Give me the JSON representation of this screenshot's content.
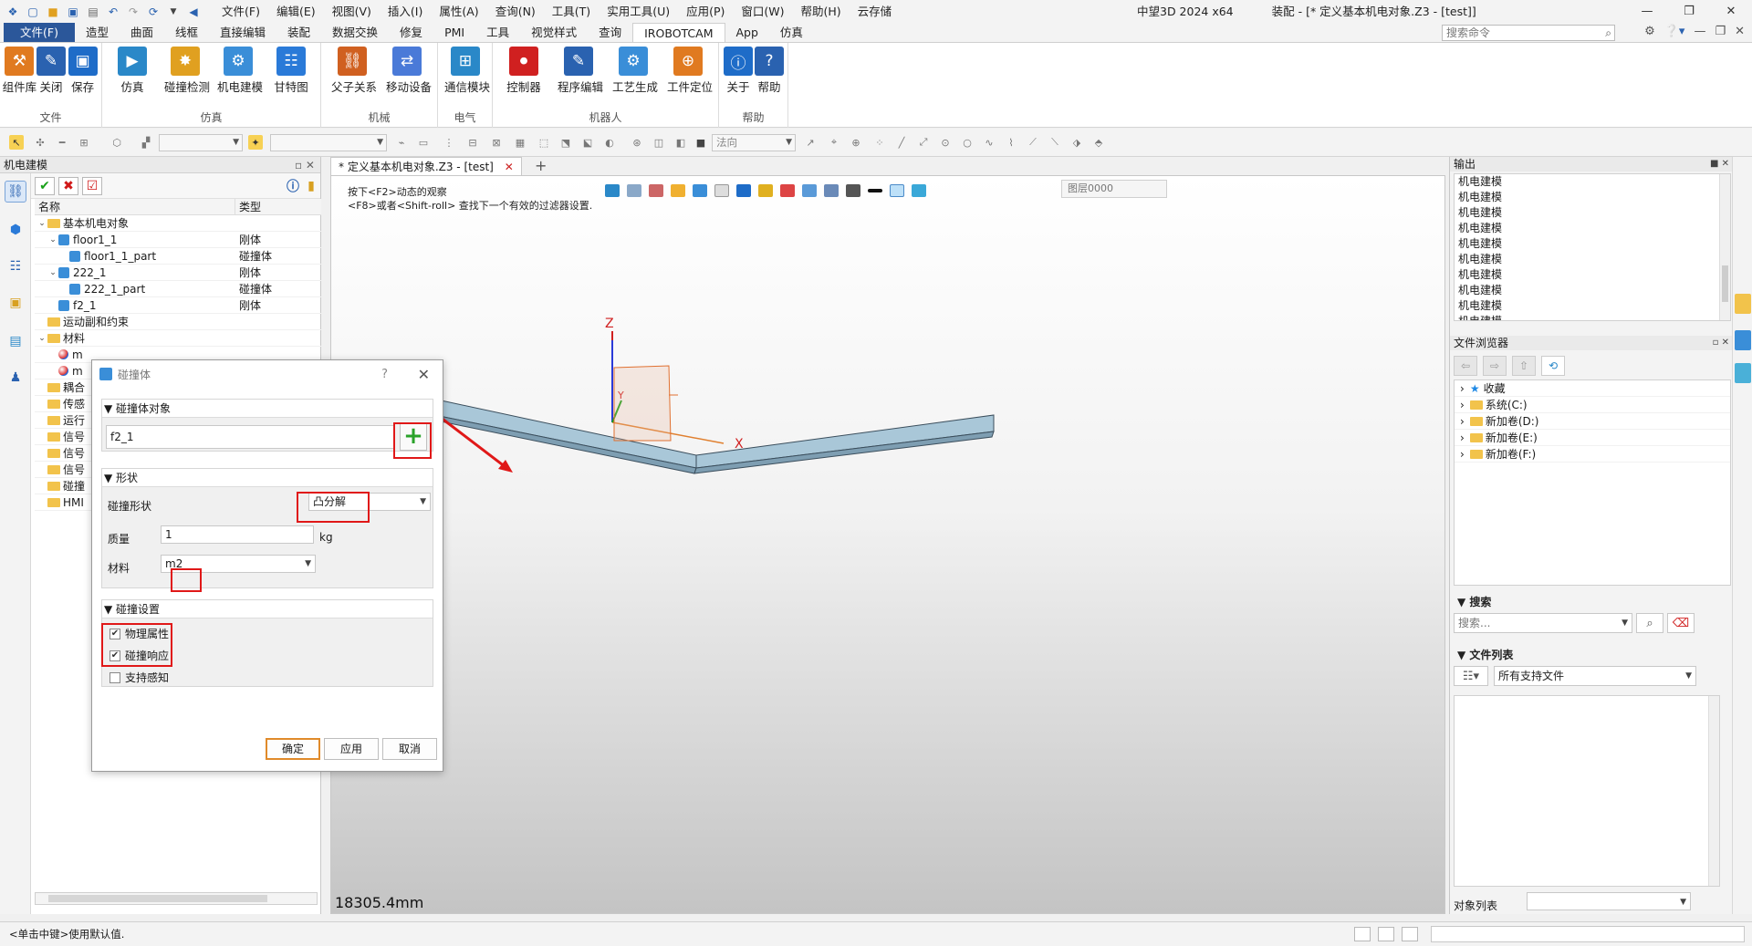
{
  "titlebar": {
    "menu": [
      "文件(F)",
      "编辑(E)",
      "视图(V)",
      "插入(I)",
      "属性(A)",
      "查询(N)",
      "工具(T)",
      "实用工具(U)",
      "应用(P)",
      "窗口(W)",
      "帮助(H)",
      "云存储"
    ],
    "app_name": "中望3D 2024 x64",
    "doc_title": "装配 - [* 定义基本机电对象.Z3 - [test]]",
    "search_placeholder": "搜索命令"
  },
  "ribbon_tabs": [
    "文件(F)",
    "造型",
    "曲面",
    "线框",
    "直接编辑",
    "装配",
    "数据交换",
    "修复",
    "PMI",
    "工具",
    "视觉样式",
    "查询",
    "IROBOTCAM",
    "App",
    "仿真"
  ],
  "ribbon_active_tab": "IROBOTCAM",
  "ribbon": {
    "groups": [
      {
        "label": "文件",
        "buttons": [
          "组件库",
          "关闭",
          "保存"
        ]
      },
      {
        "label": "仿真",
        "buttons": [
          "仿真",
          "碰撞检测",
          "机电建模",
          "甘特图"
        ]
      },
      {
        "label": "机械",
        "buttons": [
          "父子关系",
          "移动设备"
        ]
      },
      {
        "label": "电气",
        "buttons": [
          "通信模块"
        ]
      },
      {
        "label": "机器人",
        "buttons": [
          "控制器",
          "程序编辑",
          "工艺生成",
          "工件定位"
        ]
      },
      {
        "label": "帮助",
        "buttons": [
          "关于",
          "帮助"
        ]
      }
    ]
  },
  "toolbar": {
    "filter_combo": "法向"
  },
  "left_panel": {
    "title": "机电建模",
    "columns": [
      "名称",
      "类型"
    ],
    "tree": [
      {
        "name": "基本机电对象",
        "type": "",
        "level": 0,
        "kind": "folder",
        "expanded": true
      },
      {
        "name": "floor1_1",
        "type": "刚体",
        "level": 1,
        "kind": "cube",
        "expanded": true
      },
      {
        "name": "floor1_1_part",
        "type": "碰撞体",
        "level": 2,
        "kind": "cube"
      },
      {
        "name": "222_1",
        "type": "刚体",
        "level": 1,
        "kind": "cube",
        "expanded": true
      },
      {
        "name": "222_1_part",
        "type": "碰撞体",
        "level": 2,
        "kind": "cube"
      },
      {
        "name": "f2_1",
        "type": "刚体",
        "level": 1,
        "kind": "cube"
      },
      {
        "name": "运动副和约束",
        "type": "",
        "level": 0,
        "kind": "folder"
      },
      {
        "name": "材料",
        "type": "",
        "level": 0,
        "kind": "folder",
        "expanded": true
      },
      {
        "name": "m",
        "type": "",
        "level": 1,
        "kind": "ball"
      },
      {
        "name": "m",
        "type": "",
        "level": 1,
        "kind": "ball"
      },
      {
        "name": "耦合",
        "type": "",
        "level": 0,
        "kind": "folder"
      },
      {
        "name": "传感",
        "type": "",
        "level": 0,
        "kind": "folder"
      },
      {
        "name": "运行",
        "type": "",
        "level": 0,
        "kind": "folder"
      },
      {
        "name": "信号",
        "type": "",
        "level": 0,
        "kind": "folder"
      },
      {
        "name": "信号",
        "type": "",
        "level": 0,
        "kind": "folder"
      },
      {
        "name": "信号",
        "type": "",
        "level": 0,
        "kind": "folder"
      },
      {
        "name": "碰撞",
        "type": "",
        "level": 0,
        "kind": "folder"
      },
      {
        "name": "HMI",
        "type": "",
        "level": 0,
        "kind": "folder"
      }
    ]
  },
  "document_tab": "* 定义基本机电对象.Z3 - [test]",
  "viewport": {
    "hint_line1": "按下<F2>动态的观察",
    "hint_line2": "<F8>或者<Shift-roll> 查找下一个有效的过滤器设置.",
    "layer": "图层0000",
    "distance": "18305.4mm",
    "axis_z": "Z",
    "axis_x": "X",
    "axis_x2": "X",
    "axis_y": "Y"
  },
  "dialog": {
    "title": "碰撞体",
    "help": "?",
    "section_target": "碰撞体对象",
    "target_value": "f2_1",
    "section_shape": "形状",
    "shape_label": "碰撞形状",
    "shape_value": "凸分解",
    "mass_label": "质量",
    "mass_value": "1",
    "mass_unit": "kg",
    "material_label": "材料",
    "material_value": "m2",
    "section_settings": "碰撞设置",
    "checks": [
      {
        "label": "物理属性",
        "checked": true
      },
      {
        "label": "碰撞响应",
        "checked": true
      },
      {
        "label": "支持感知",
        "checked": false
      }
    ],
    "ok": "确定",
    "apply": "应用",
    "cancel": "取消"
  },
  "right_panel": {
    "output_title": "输出",
    "output_lines": [
      "机电建模",
      "机电建模",
      "机电建模",
      "机电建模",
      "机电建模",
      "机电建模",
      "机电建模",
      "机电建模",
      "机电建模",
      "机电建模"
    ],
    "browser_title": "文件浏览器",
    "browser_items": [
      "收藏",
      "系统(C:)",
      "新加卷(D:)",
      "新加卷(E:)",
      "新加卷(F:)"
    ],
    "search_title": "搜索",
    "search_placeholder": "搜索...",
    "file_list_title": "文件列表",
    "file_filter": "所有支持文件",
    "object_list_label": "对象列表"
  },
  "status": {
    "text": "<单击中键>使用默认值."
  },
  "colors": {
    "accent": "#2b579a",
    "highlight_red": "#e01818",
    "beam_fill": "#a9c7d8",
    "beam_stroke": "#3b4e5c"
  }
}
